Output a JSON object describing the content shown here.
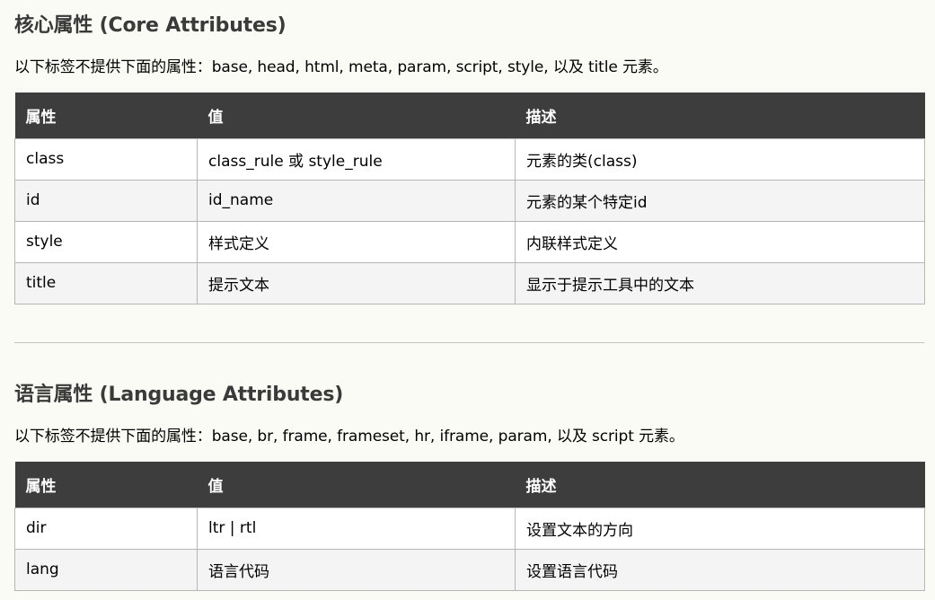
{
  "core": {
    "title": "核心属性 (Core Attributes)",
    "description": "以下标签不提供下面的属性：base, head, html, meta, param, script, style, 以及 title 元素。",
    "headers": [
      "属性",
      "值",
      "描述"
    ],
    "rows": [
      [
        "class",
        "class_rule 或 style_rule",
        "元素的类(class)"
      ],
      [
        "id",
        "id_name",
        "元素的某个特定id"
      ],
      [
        "style",
        "样式定义",
        "内联样式定义"
      ],
      [
        "title",
        "提示文本",
        "显示于提示工具中的文本"
      ]
    ]
  },
  "language": {
    "title": "语言属性 (Language Attributes)",
    "description": "以下标签不提供下面的属性：base, br, frame, frameset, hr, iframe, param, 以及 script 元素。",
    "headers": [
      "属性",
      "值",
      "描述"
    ],
    "rows": [
      [
        "dir",
        "ltr | rtl",
        "设置文本的方向"
      ],
      [
        "lang",
        "语言代码",
        "设置语言代码"
      ]
    ]
  },
  "colors": {
    "background": "#fbfbf6",
    "header_bg": "#3d3d3d",
    "header_text": "#ffffff",
    "title_text": "#3a3a3a",
    "row_alt": "#f4f4f4",
    "border": "#b6b6b6"
  }
}
